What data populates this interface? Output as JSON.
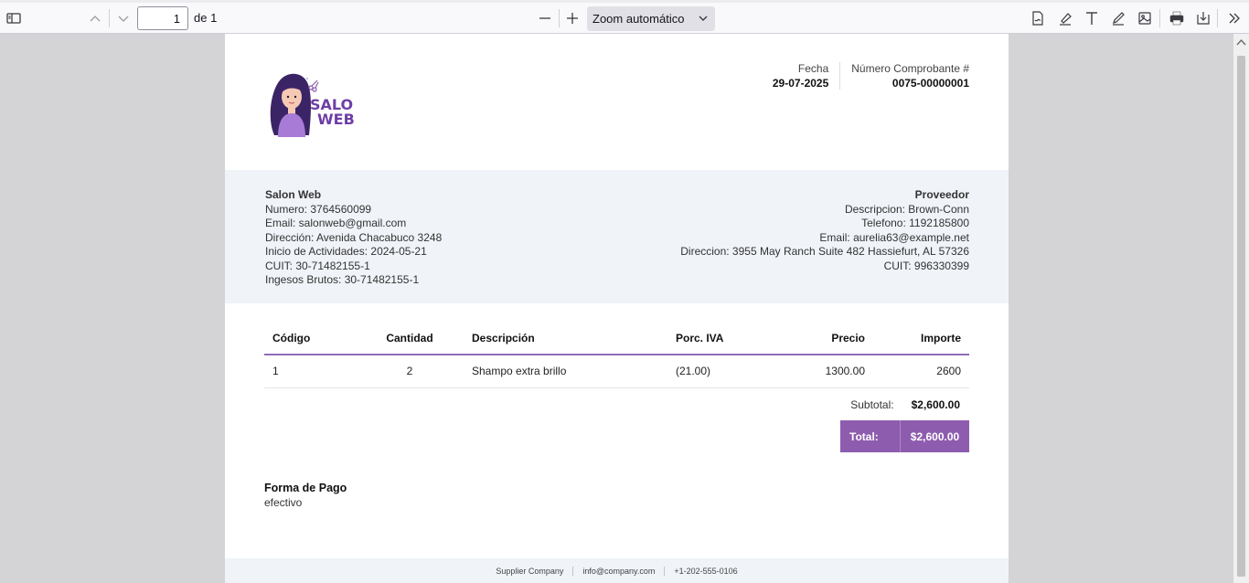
{
  "toolbar": {
    "page_number": "1",
    "page_of": "de 1",
    "zoom_label": "Zoom automático"
  },
  "invoice": {
    "fecha_label": "Fecha",
    "fecha_value": "29-07-2025",
    "numero_label": "Número Comprobante #",
    "numero_value": "0075-00000001",
    "logo_text_1": "SALON",
    "logo_text_2": "WEB"
  },
  "emisor": {
    "name": "Salon Web",
    "numero": "Numero: 3764560099",
    "email": "Email: salonweb@gmail.com",
    "direccion": "Dirección: Avenida Chacabuco 3248",
    "inicio": "Inicio de Actividades: 2024-05-21",
    "cuit": "CUIT: 30-71482155-1",
    "ingresos": "Ingesos Brutos: 30-71482155-1"
  },
  "proveedor": {
    "title": "Proveedor",
    "descripcion": "Descripcion: Brown-Conn",
    "telefono": "Telefono: 1192185800",
    "email": "Email: aurelia63@example.net",
    "direccion": "Direccion: 3955 May Ranch Suite 482 Hassiefurt, AL 57326",
    "cuit": "CUIT: 996330399"
  },
  "table": {
    "headers": [
      "Código",
      "Cantidad",
      "Descripción",
      "Porc. IVA",
      "Precio",
      "Importe"
    ],
    "rows": [
      [
        "1",
        "2",
        "Shampo extra brillo",
        "(21.00)",
        "1300.00",
        "2600"
      ]
    ]
  },
  "totals": {
    "subtotal_label": "Subtotal:",
    "subtotal_value": "$2,600.00",
    "total_label": "Total:",
    "total_value": "$2,600.00"
  },
  "payment": {
    "label": "Forma de Pago",
    "value": "efectivo"
  },
  "footer": {
    "company": "Supplier Company",
    "email": "info@company.com",
    "phone": "+1-202-555-0106"
  },
  "colors": {
    "accent": "#8e5cae",
    "band": "#f0f3f8"
  }
}
